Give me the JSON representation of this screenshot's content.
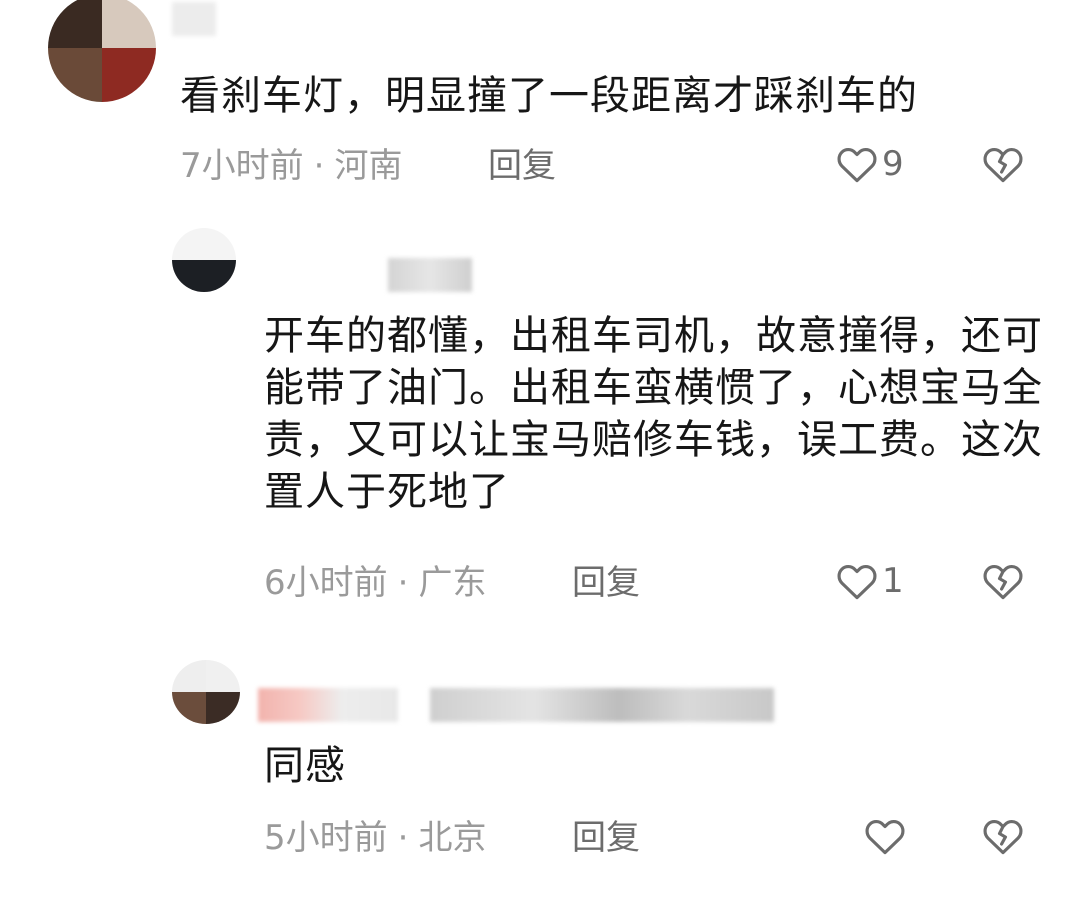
{
  "comments": [
    {
      "text": "看刹车灯，明显撞了一段距离才踩刹车的",
      "time": "7小时前",
      "location": "河南",
      "reply_label": "回复",
      "like_count": "9",
      "like_icon": "heart-outline-icon",
      "dislike_icon": "broken-heart-icon"
    },
    {
      "text": "开车的都懂，出租车司机，故意撞得，还可能带了油门。出租车蛮横惯了，心想宝马全责，又可以让宝马赔修车钱，误工费。这次置人于死地了",
      "time": "6小时前",
      "location": "广东",
      "reply_label": "回复",
      "like_count": "1",
      "like_icon": "heart-outline-icon",
      "dislike_icon": "broken-heart-icon"
    },
    {
      "text": "同感",
      "time": "5小时前",
      "location": "北京",
      "reply_label": "回复",
      "like_count": "",
      "like_icon": "heart-outline-icon",
      "dislike_icon": "broken-heart-icon"
    }
  ],
  "meta_separator": "·",
  "colors": {
    "text": "#161616",
    "meta": "#9a9a9a",
    "action": "#6c6c6c",
    "background": "#ffffff"
  }
}
